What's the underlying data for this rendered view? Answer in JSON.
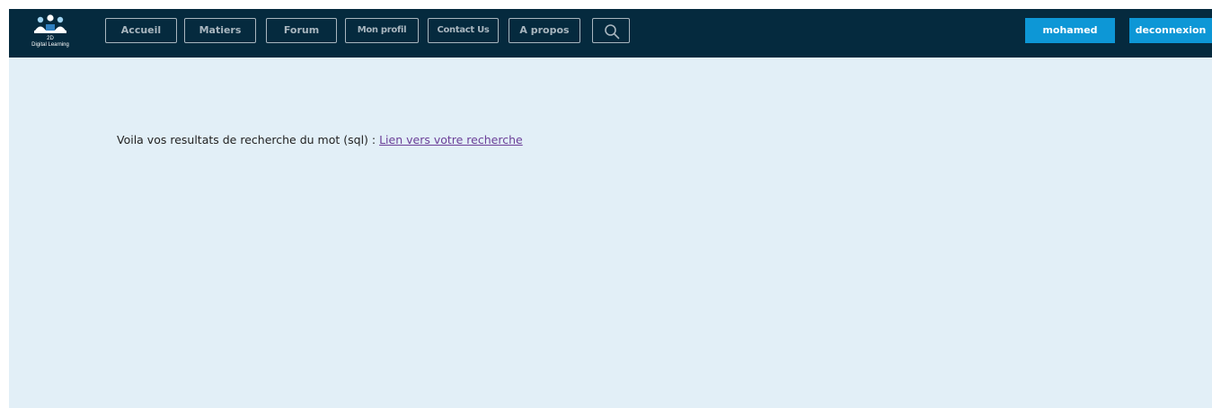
{
  "brand": {
    "abbr": "2D",
    "name": "Digital Learning"
  },
  "nav": {
    "items": [
      "Accueil",
      "Matiers",
      "Forum",
      "Mon profil",
      "Contact Us",
      "A propos"
    ],
    "search_icon": "search-icon"
  },
  "user": {
    "name_label": "mohamed",
    "logout_label": "deconnexion"
  },
  "results": {
    "prefix": "Voila vos resultats de recherche du mot (sql) : ",
    "link_text": "Lien vers votre recherche"
  },
  "colors": {
    "navbar": "#052a3e",
    "background": "#e2eff7",
    "accent": "#0d97d6",
    "nav_outline": "#a9b6bf",
    "link": "#6b3f98"
  }
}
